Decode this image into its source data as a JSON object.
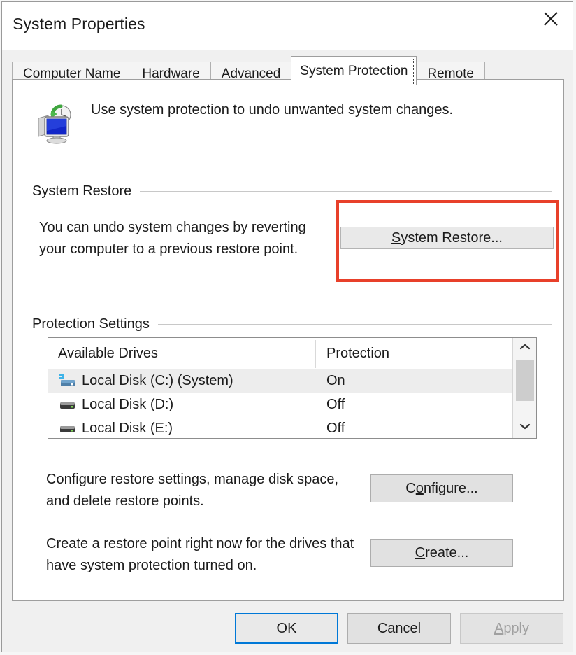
{
  "window": {
    "title": "System Properties",
    "close_icon": "close-icon"
  },
  "tabs": [
    {
      "label": "Computer Name",
      "active": false
    },
    {
      "label": "Hardware",
      "active": false
    },
    {
      "label": "Advanced",
      "active": false
    },
    {
      "label": "System Protection",
      "active": true
    },
    {
      "label": "Remote",
      "active": false
    }
  ],
  "header": {
    "icon": "system-restore-monitor-icon",
    "description": "Use system protection to undo unwanted system changes."
  },
  "system_restore": {
    "group_label": "System Restore",
    "description_line1": "You can undo system changes by reverting",
    "description_line2": "your computer to a previous restore point.",
    "button": {
      "accel": "S",
      "rest": "ystem Restore..."
    },
    "highlight_color": "#e8402a"
  },
  "protection_settings": {
    "group_label": "Protection Settings",
    "columns": [
      "Available Drives",
      "Protection"
    ],
    "rows": [
      {
        "icon": "system-drive-icon",
        "drive": "Local Disk (C:) (System)",
        "protection": "On",
        "selected": true
      },
      {
        "icon": "drive-icon",
        "drive": "Local Disk (D:)",
        "protection": "Off",
        "selected": false
      },
      {
        "icon": "drive-icon",
        "drive": "Local Disk (E:)",
        "protection": "Off",
        "selected": false
      }
    ],
    "scrollbar": {
      "up_icon": "chevron-up-icon",
      "down_icon": "chevron-down-icon"
    }
  },
  "configure": {
    "description_line1": "Configure restore settings, manage disk space,",
    "description_line2": "and delete restore points.",
    "button": {
      "pre": "C",
      "accel": "o",
      "rest": "nfigure..."
    }
  },
  "create": {
    "description_line1": "Create a restore point right now for the drives that",
    "description_line2": "have system protection turned on.",
    "button": {
      "pre": "",
      "accel": "C",
      "rest": "reate..."
    }
  },
  "footer": {
    "ok": "OK",
    "cancel": "Cancel",
    "apply": {
      "accel": "A",
      "rest": "pply"
    }
  }
}
